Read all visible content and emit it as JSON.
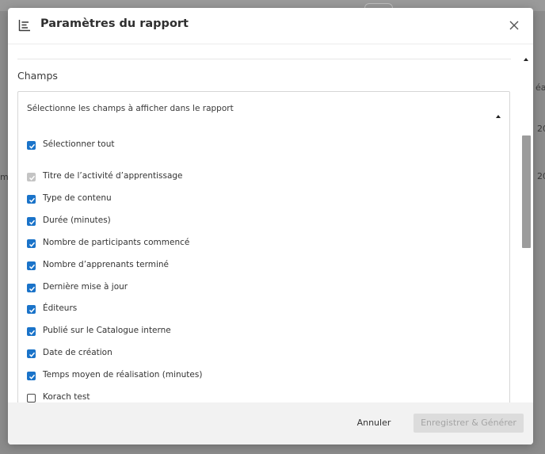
{
  "background": {
    "fragments": [
      "éat",
      "20",
      "m",
      "20"
    ]
  },
  "dialog": {
    "title": "Paramètres du rapport",
    "header_icon": "report-list-icon",
    "close_icon": "close-icon"
  },
  "section": {
    "label": "Champs"
  },
  "fields": {
    "header": "Sélectionne les champs à afficher dans le rapport",
    "select_all": {
      "label": "Sélectionner tout",
      "checked": true
    },
    "items": [
      {
        "label": "Titre de l’activité d’apprentissage",
        "state": "disabled"
      },
      {
        "label": "Type de contenu",
        "state": "checked"
      },
      {
        "label": "Durée (minutes)",
        "state": "checked"
      },
      {
        "label": "Nombre de participants commencé",
        "state": "checked"
      },
      {
        "label": "Nombre d’apprenants terminé",
        "state": "checked"
      },
      {
        "label": "Dernière mise à jour",
        "state": "checked"
      },
      {
        "label": "Éditeurs",
        "state": "checked"
      },
      {
        "label": "Publié sur le Catalogue interne",
        "state": "checked"
      },
      {
        "label": "Date de création",
        "state": "checked"
      },
      {
        "label": "Temps moyen de réalisation (minutes)",
        "state": "checked"
      },
      {
        "label": "Korach test",
        "state": "unchecked"
      }
    ]
  },
  "footer": {
    "cancel_label": "Annuler",
    "save_label": "Enregistrer & Générer"
  },
  "colors": {
    "accent": "#1a73c9",
    "disabled_check": "#c4c4c4",
    "footer_bg": "#f2f2f2"
  }
}
